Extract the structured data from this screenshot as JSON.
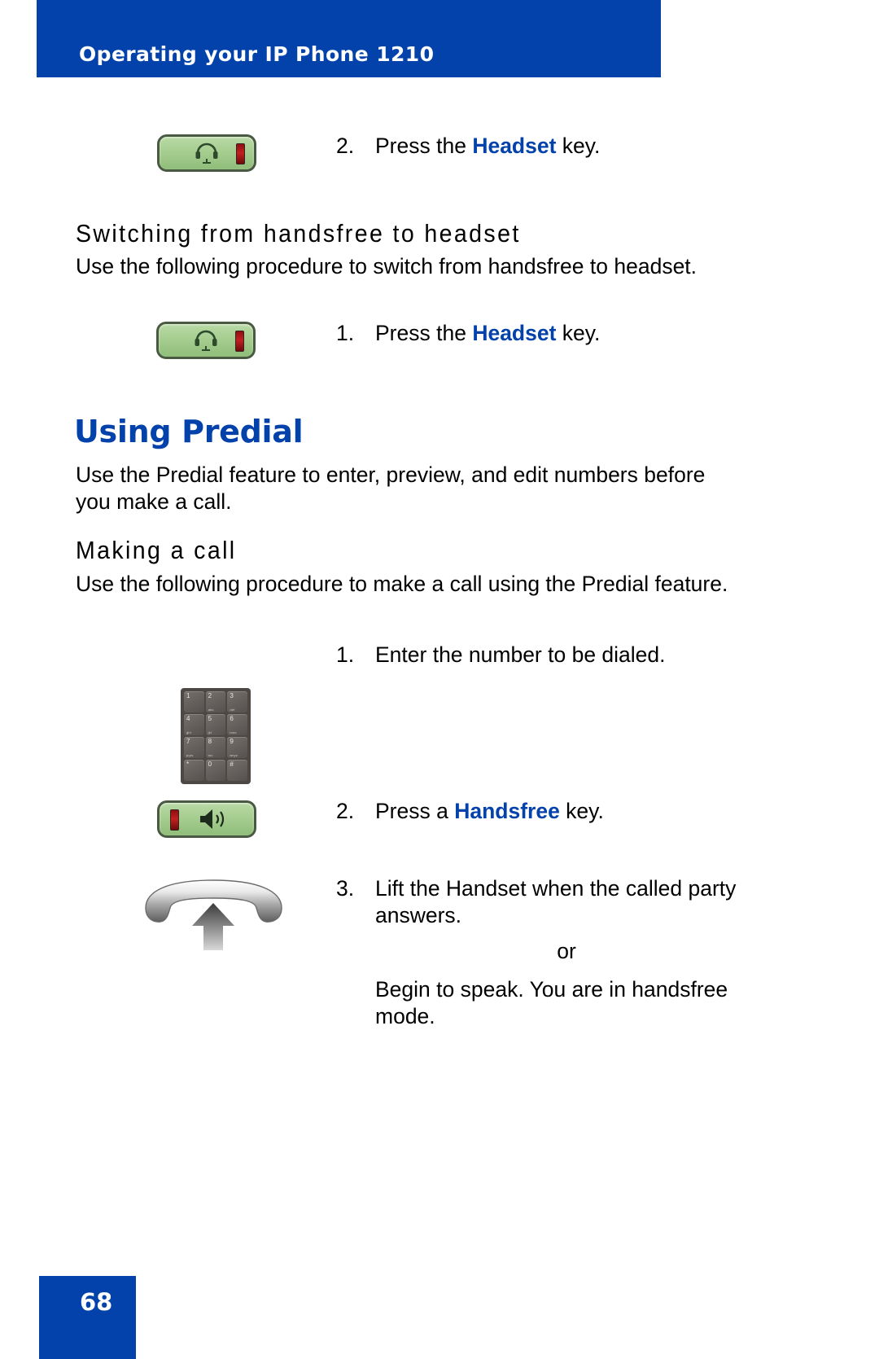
{
  "header": {
    "title": "Operating your IP Phone 1210"
  },
  "footer": {
    "page_number": "68"
  },
  "colors": {
    "brand_blue": "#0442ab",
    "key_green": "#a9cf93",
    "led_red": "#c22020",
    "keypad_gray": "#4e4845"
  },
  "blocks": {
    "step_headset_2": {
      "number": "2.",
      "text_before": "Press the ",
      "keyword": "Headset",
      "text_after": " key.",
      "icon": "headset-key-icon"
    },
    "heading_switching": "Switching from handsfree to headset",
    "para_switching": "Use the following procedure to switch from handsfree to headset.",
    "step_headset_1": {
      "number": "1.",
      "text_before": "Press the ",
      "keyword": "Headset",
      "text_after": " key.",
      "icon": "headset-key-icon"
    },
    "heading_using_predial": "Using Predial",
    "para_predial": "Use the Predial feature to enter, preview, and edit numbers before you make a call.",
    "heading_making_call": "Making a call",
    "para_making_call": "Use the following procedure to make a call using the Predial feature.",
    "step_enter_number": {
      "number": "1.",
      "text": "Enter the number to be dialed.",
      "icon": "dialpad-keypad-icon"
    },
    "step_handsfree": {
      "number": "2.",
      "text_before": "Press a ",
      "keyword": "Handsfree",
      "text_after": " key.",
      "icon": "handsfree-key-icon"
    },
    "step_lift_handset": {
      "number": "3.",
      "text": "Lift the Handset when the called party answers.",
      "or_label": "or",
      "alt_text": "Begin to speak. You are in handsfree mode.",
      "icon": "lift-handset-icon"
    }
  },
  "keypad": {
    "keys": [
      {
        "num": "1",
        "alpha": ""
      },
      {
        "num": "2",
        "alpha": "abc"
      },
      {
        "num": "3",
        "alpha": "def"
      },
      {
        "num": "4",
        "alpha": "ghi"
      },
      {
        "num": "5",
        "alpha": "jkl"
      },
      {
        "num": "6",
        "alpha": "mno"
      },
      {
        "num": "7",
        "alpha": "pqrs"
      },
      {
        "num": "8",
        "alpha": "tuv"
      },
      {
        "num": "9",
        "alpha": "wxyz"
      },
      {
        "num": "*",
        "alpha": ""
      },
      {
        "num": "0",
        "alpha": ""
      },
      {
        "num": "#",
        "alpha": ""
      }
    ]
  }
}
